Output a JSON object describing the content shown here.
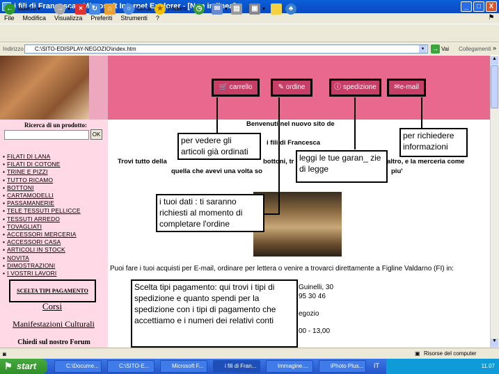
{
  "window": {
    "title": "i fili di Francesca - Microsoft Internet Explorer - [Non in linea]",
    "minimize": "_",
    "maximize": "□",
    "close": "X"
  },
  "menu": [
    "File",
    "Modifica",
    "Visualizza",
    "Preferiti",
    "Strumenti",
    "?"
  ],
  "toolbar": {
    "back": "Indietro",
    "search": "Cerca",
    "favorites": "Preferiti"
  },
  "address": {
    "label": "Indirizzo",
    "value": "C:\\SITO-EDISPLAY-NEGOZIO\\index.htm",
    "go": "Vai",
    "links": "Collegamenti"
  },
  "site": {
    "nav": [
      "carrello",
      "ordine",
      "spedizione",
      "e-mail"
    ],
    "search_label": "Ricerca di un prodotto:",
    "search_ok": "OK",
    "categories": [
      "FILATI DI LANA",
      "FILATI DI COTONE",
      "TRINE E PIZZI",
      "TUTTO RICAMO",
      "BOTTONI",
      "CARTAMODELLI",
      "PASSAMANERIE",
      "TELE TESSUTI PELLICCE",
      "TESSUTI ARREDO",
      "TOVAGLIATI",
      "ACCESSORI MERCERIA",
      "ACCESSORI CASA",
      "ARTICOLI IN STOCK",
      "NOVITA",
      "DIMOSTRAZIONI",
      "I VOSTRI LAVORI"
    ],
    "payment_link": "SCELTA TIPI PAGAMENTO",
    "corsi": "Corsi",
    "manifestazioni": "Manifestazioni Culturali",
    "chiedi": "Chiedi sul nostro Forum",
    "welcome": "Benvenuti nel nuovo sito de",
    "shop_name": "i fili di Francesca",
    "intro_left": "Trovi tutto della",
    "intro_mid": "bottoni, tr",
    "intro_right": "altro, e  la merceria come",
    "intro_line2_left": "quella che avevi una volta so",
    "intro_line2_right": "piu'",
    "bottom_text": "Puoi fare i tuoi acquisti per E-mail, ordinare per lettera o venire a trovarci direttamente a Figline Valdarno (FI) in:",
    "addr1": "Guinelli, 30",
    "addr2": "95 30 46",
    "addr3": "egozio",
    "hours": "00 - 13,00"
  },
  "callouts": {
    "carrello": "per vedere gli articoli già ordinati",
    "ordine": "i tuoi dati : ti saranno richiesti al momento di completare l'ordine",
    "spedizione": "leggi le tue  garan_ zie di legge",
    "email": "per richiedere informazioni",
    "pagamento": "Scelta tipi pagamento: qui trovi i tipi di spedizione e quanto spendi per la spedizione con i tipi di pagamento che accettiamo e i numeri dei relativi  conti"
  },
  "status": {
    "zone": "Risorse del computer"
  },
  "taskbar": {
    "start": "start",
    "tasks": [
      "C:\\Docume...",
      "C:\\SITO-E...",
      "Microsoft F...",
      "i fili di Fran...",
      "Immagine....",
      "iPhoto Plus..."
    ],
    "lang": "IT",
    "clock": "11.07"
  }
}
